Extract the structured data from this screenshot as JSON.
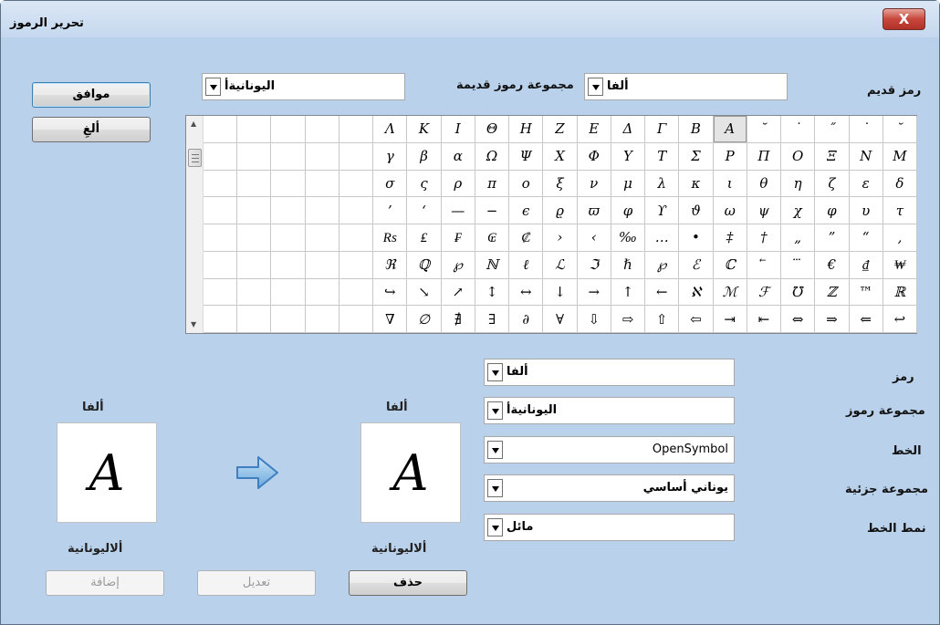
{
  "window": {
    "title": "تحرير الرموز",
    "close_label": "X"
  },
  "buttons": {
    "ok": "موافق",
    "cancel": "ألغِ",
    "add": "إضافة",
    "modify": "تعديل",
    "delete": "حذف"
  },
  "old_symbol": {
    "label": "رمز قديم",
    "value": "ألفا"
  },
  "old_symbol_set": {
    "label": "مجموعة رموز قديمة",
    "value": "اليونانيةأ"
  },
  "form": {
    "symbol_label": "رمز",
    "symbol_value": "ألفا",
    "symbol_set_label": "مجموعة رموز",
    "symbol_set_value": "اليونانيةأ",
    "font_label": "الخط",
    "font_value": "OpenSymbol",
    "subset_label": "مجموعة جزئية",
    "subset_value": "يوناني أساسي",
    "typeface_label": "نمط الخط",
    "typeface_value": "مائل"
  },
  "preview_new": {
    "name": "ألفا",
    "glyph": "A",
    "set": "ألاليونانية"
  },
  "preview_old": {
    "name": "ألفا",
    "glyph": "A",
    "set": "ألاليونانية"
  },
  "symbol_grid": [
    [
      "˘",
      "˙",
      "˝",
      "˙",
      "˘",
      "A",
      "B",
      "Γ",
      "Δ",
      "E",
      "Z",
      "H",
      "Θ",
      "I",
      "K",
      "Λ"
    ],
    [
      "M",
      "N",
      "Ξ",
      "O",
      "Π",
      "P",
      "Σ",
      "T",
      "Y",
      "Φ",
      "X",
      "Ψ",
      "Ω",
      "α",
      "β",
      "γ"
    ],
    [
      "δ",
      "ε",
      "ζ",
      "η",
      "θ",
      "ι",
      "κ",
      "λ",
      "μ",
      "ν",
      "ξ",
      "ο",
      "π",
      "ρ",
      "ς",
      "σ"
    ],
    [
      "τ",
      "υ",
      "φ",
      "χ",
      "ψ",
      "ω",
      "ϑ",
      "ϒ",
      "φ",
      "ϖ",
      "ϱ",
      "ϵ",
      "−",
      "—",
      "‘",
      "’"
    ],
    [
      "‚",
      "“",
      "”",
      "„",
      "†",
      "‡",
      "•",
      "…",
      "‰",
      "‹",
      "›",
      "₡",
      "₢",
      "₣",
      "₤",
      "₨"
    ],
    [
      "₩",
      "₫",
      "€",
      "⃛",
      "⃖",
      "ℂ",
      "ℰ",
      "℘",
      "ℏ",
      "ℑ",
      "ℒ",
      "ℓ",
      "ℕ",
      "℘",
      "ℚ",
      "ℜ"
    ],
    [
      "ℝ",
      "™",
      "ℤ",
      "℧",
      "ℱ",
      "ℳ",
      "ℵ",
      "←",
      "↑",
      "→",
      "↓",
      "↔",
      "↕",
      "↗",
      "↘",
      "↪"
    ],
    [
      "↩",
      "⇐",
      "⇒",
      "⇔",
      "⇤",
      "⇥",
      "⇦",
      "⇧",
      "⇨",
      "⇩",
      "∀",
      "∂",
      "∃",
      "∄",
      "∅",
      "∇"
    ]
  ],
  "colors": {
    "dialog_bg": "#f0f0f0",
    "titlebar": "#c5d8ee",
    "close": "#c7473c",
    "arrow": "#5b9bd5"
  }
}
